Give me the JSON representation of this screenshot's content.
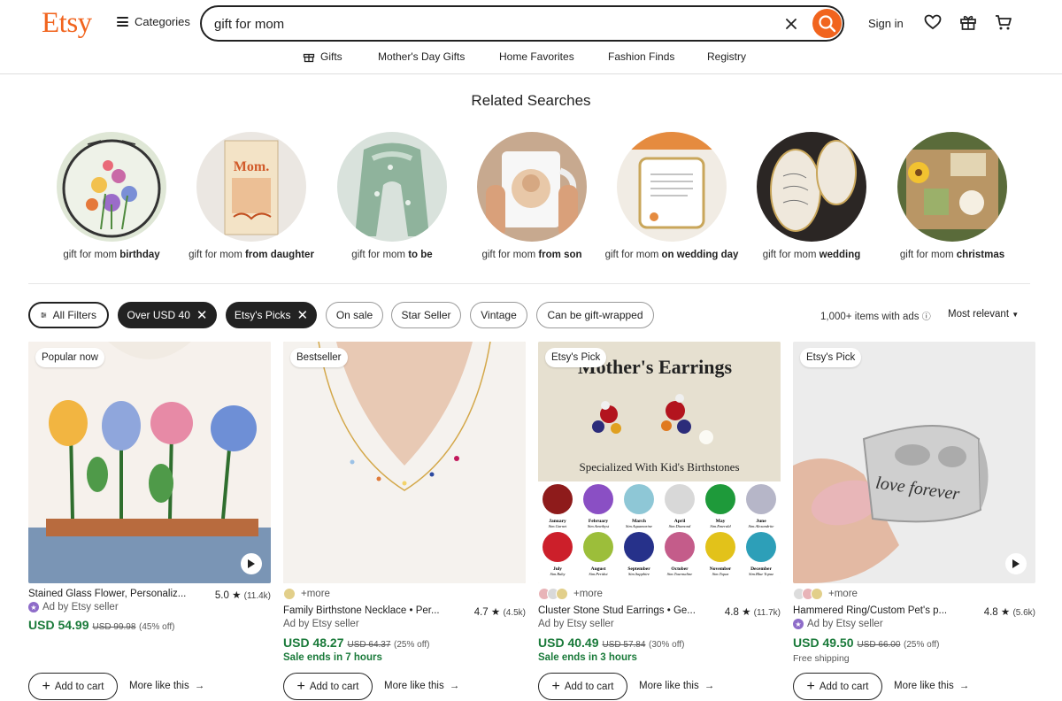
{
  "header": {
    "logo": "Etsy",
    "categories_label": "Categories",
    "search_value": "gift for mom",
    "signin_label": "Sign in"
  },
  "subnav": [
    "Gifts",
    "Mother's Day Gifts",
    "Home Favorites",
    "Fashion Finds",
    "Registry"
  ],
  "related": {
    "title": "Related Searches",
    "items": [
      {
        "prefix": "gift for mom ",
        "bold": "birthday",
        "image": "stained glass floral suncatcher"
      },
      {
        "prefix": "gift for mom ",
        "bold": "from daughter",
        "image": "Mom I want to hear your story book"
      },
      {
        "prefix": "gift for mom ",
        "bold": "to be",
        "image": "floral neck pillow"
      },
      {
        "prefix": "gift for mom ",
        "bold": "from son",
        "image": "photo mug"
      },
      {
        "prefix": "gift for mom ",
        "bold": "on wedding day",
        "image": "ring dish"
      },
      {
        "prefix": "gift for mom ",
        "bold": "wedding",
        "image": "mother of the bride trinket dishes"
      },
      {
        "prefix": "gift for mom ",
        "bold": "christmas",
        "image": "gift box set"
      }
    ]
  },
  "filters": {
    "all_filters": "All Filters",
    "chips": [
      "Over USD 40",
      "Etsy's Picks",
      "On sale",
      "Star Seller",
      "Vintage",
      "Can be gift-wrapped"
    ],
    "results": "1,000+ items with ads",
    "sort": "Most relevant"
  },
  "products": [
    {
      "badge": "Popular now",
      "title": "Stained Glass Flower, Personaliz...",
      "rating": "5.0",
      "count": "(11.4k)",
      "seller": "Ad by Etsy seller",
      "price": "USD 54.99",
      "orig": "USD 99.98",
      "off": "(45% off)",
      "add_to_cart": "Add to cart",
      "more_like": "More like this"
    },
    {
      "badge": "Bestseller",
      "more_options": "+more",
      "title": "Family Birthstone Necklace • Per...",
      "rating": "4.7",
      "count": "(4.5k)",
      "seller": "Ad by Etsy seller",
      "price": "USD 48.27",
      "orig": "USD 64.37",
      "off": "(25% off)",
      "sale": "Sale ends in 7 hours",
      "add_to_cart": "Add to cart",
      "more_like": "More like this"
    },
    {
      "badge": "Etsy's Pick",
      "more_options": "+more",
      "title": "Cluster Stone Stud Earrings • Ge...",
      "rating": "4.8",
      "count": "(11.7k)",
      "seller": "Ad by Etsy seller",
      "price": "USD 40.49",
      "orig": "USD 57.84",
      "off": "(30% off)",
      "sale": "Sale ends in 3 hours",
      "add_to_cart": "Add to cart",
      "more_like": "More like this",
      "image_text": {
        "heading": "Mother's Earrings",
        "subheading": "Specialized With Kid's Birthstones",
        "months": [
          {
            "m": "January",
            "s": "Sim.Garnet"
          },
          {
            "m": "February",
            "s": "Sim.Amethyst"
          },
          {
            "m": "March",
            "s": "Sim.Aquamarine"
          },
          {
            "m": "April",
            "s": "Sim.Diamond"
          },
          {
            "m": "May",
            "s": "Sim.Emerald"
          },
          {
            "m": "June",
            "s": "Sim.Alexandrite"
          },
          {
            "m": "July",
            "s": "Sim.Ruby"
          },
          {
            "m": "August",
            "s": "Sim.Peridot"
          },
          {
            "m": "September",
            "s": "Sim.Sapphire"
          },
          {
            "m": "October",
            "s": "Sim.Tourmaline"
          },
          {
            "m": "November",
            "s": "Sim.Topaz"
          },
          {
            "m": "December",
            "s": "Sim.Blue Topaz"
          }
        ]
      }
    },
    {
      "badge": "Etsy's Pick",
      "more_options": "+more",
      "title": "Hammered Ring/Custom Pet's p...",
      "rating": "4.8",
      "count": "(5.6k)",
      "seller": "Ad by Etsy seller",
      "price": "USD 49.50",
      "orig": "USD 66.00",
      "off": "(25% off)",
      "shipping": "Free shipping",
      "add_to_cart": "Add to cart",
      "more_like": "More like this",
      "image_text": {
        "engraving": "love forever"
      }
    }
  ],
  "colors": {
    "brand": "#f1641e",
    "price": "#1a7a3a",
    "dark": "#222222"
  }
}
